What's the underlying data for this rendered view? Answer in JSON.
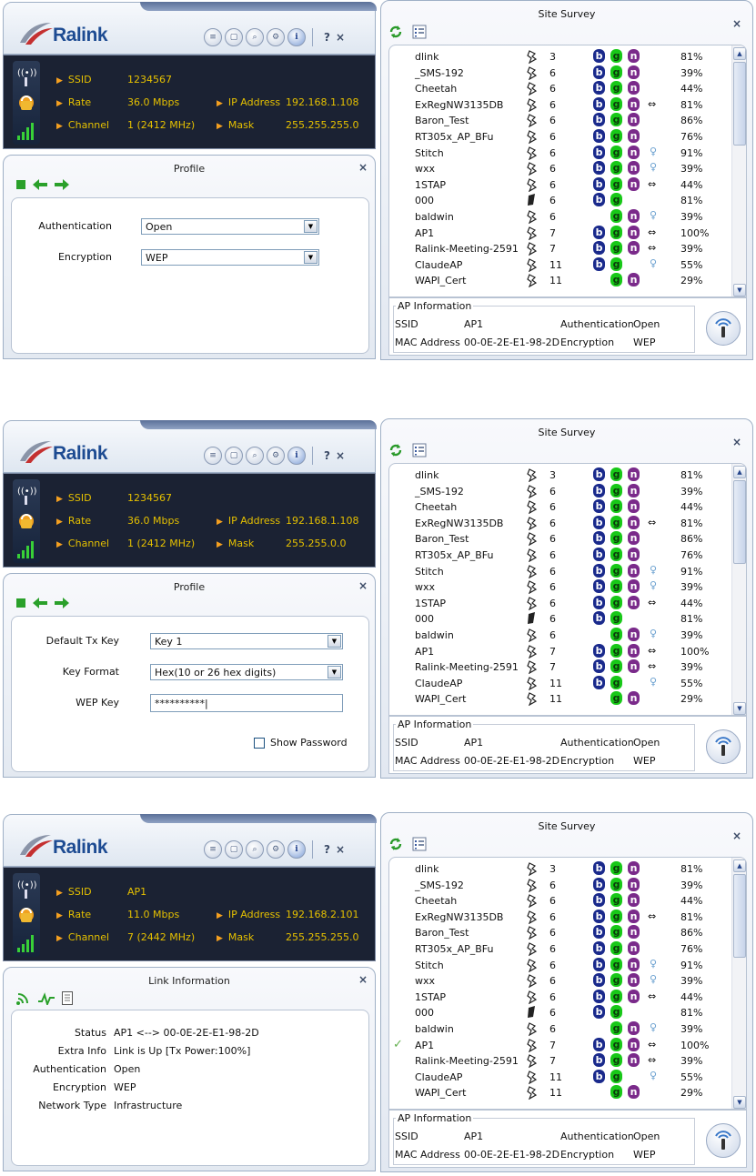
{
  "brand": {
    "logo_text": "Ralink"
  },
  "toolbar": {
    "help": "?",
    "close": "×",
    "info": "i"
  },
  "labels": {
    "ssid": "SSID",
    "rate": "Rate",
    "channel": "Channel",
    "ip": "IP Address",
    "mask": "Mask"
  },
  "survey_common": {
    "title": "Site Survey",
    "close": "×",
    "ap_legend": "AP Information",
    "ap_ssid_label": "SSID",
    "ap_ssid": "AP1",
    "ap_auth_label": "Authentication",
    "ap_auth": "Open",
    "ap_mac_label": "MAC Address",
    "ap_mac": "00-0E-2E-E1-98-2D",
    "ap_enc_label": "Encryption",
    "ap_enc": "WEP",
    "networks": [
      {
        "ssid": "dlink",
        "channel": "3",
        "b": true,
        "g": true,
        "n": true,
        "extra": "",
        "signal": "81%"
      },
      {
        "ssid": "_SMS-192",
        "channel": "6",
        "b": true,
        "g": true,
        "n": true,
        "extra": "",
        "signal": "39%"
      },
      {
        "ssid": "Cheetah",
        "channel": "6",
        "b": true,
        "g": true,
        "n": true,
        "extra": "",
        "signal": "44%"
      },
      {
        "ssid": "ExRegNW3135DB",
        "channel": "6",
        "b": true,
        "g": true,
        "n": true,
        "extra": "40mhz",
        "signal": "81%"
      },
      {
        "ssid": "Baron_Test",
        "channel": "6",
        "b": true,
        "g": true,
        "n": true,
        "extra": "",
        "signal": "86%"
      },
      {
        "ssid": "RT305x_AP_BFu",
        "channel": "6",
        "b": true,
        "g": true,
        "n": true,
        "extra": "",
        "signal": "76%"
      },
      {
        "ssid": "Stitch",
        "channel": "6",
        "b": true,
        "g": true,
        "n": true,
        "extra": "wps",
        "signal": "91%"
      },
      {
        "ssid": "wxx",
        "channel": "6",
        "b": true,
        "g": true,
        "n": true,
        "extra": "wps",
        "signal": "39%"
      },
      {
        "ssid": "1STAP",
        "channel": "6",
        "b": true,
        "g": true,
        "n": true,
        "extra": "40mhz",
        "signal": "44%"
      },
      {
        "ssid": "000",
        "channel": "6",
        "b": true,
        "g": true,
        "n": false,
        "extra": "",
        "signal": "81%"
      },
      {
        "ssid": "baldwin",
        "channel": "6",
        "b": false,
        "g": true,
        "n": true,
        "extra": "wps",
        "signal": "39%"
      },
      {
        "ssid": "AP1",
        "channel": "7",
        "b": true,
        "g": true,
        "n": true,
        "extra": "40mhz",
        "signal": "100%"
      },
      {
        "ssid": "Ralink-Meeting-2591",
        "channel": "7",
        "b": true,
        "g": true,
        "n": true,
        "extra": "40mhz",
        "signal": "39%"
      },
      {
        "ssid": "ClaudeAP",
        "channel": "11",
        "b": true,
        "g": true,
        "n": false,
        "extra": "wps",
        "signal": "55%"
      },
      {
        "ssid": "WAPI_Cert",
        "channel": "11",
        "b": false,
        "g": true,
        "n": true,
        "extra": "",
        "signal": "29%"
      }
    ]
  },
  "scenes": [
    {
      "status": {
        "ssid": "1234567",
        "rate": "36.0 Mbps",
        "channel": "1 (2412 MHz)",
        "ip": "192.168.1.108",
        "mask": "255.255.255.0"
      },
      "profile": {
        "title": "Profile",
        "close": "×",
        "auth_label": "Authentication",
        "auth_value": "Open",
        "enc_label": "Encryption",
        "enc_value": "WEP"
      }
    },
    {
      "status": {
        "ssid": "1234567",
        "rate": "36.0 Mbps",
        "channel": "1 (2412 MHz)",
        "ip": "192.168.1.108",
        "mask": "255.255.0.0"
      },
      "profile": {
        "title": "Profile",
        "close": "×",
        "txkey_label": "Default Tx Key",
        "txkey_value": "Key 1",
        "format_label": "Key Format",
        "format_value": "Hex(10 or 26 hex digits)",
        "wep_label": "WEP Key",
        "wep_value": "**********",
        "show_password": "Show Password"
      }
    },
    {
      "status": {
        "ssid": "AP1",
        "rate": "11.0 Mbps",
        "channel": "7 (2442 MHz)",
        "ip": "192.168.2.101",
        "mask": "255.255.255.0"
      },
      "link": {
        "title": "Link Information",
        "close": "×",
        "status_label": "Status",
        "status_value": "AP1 <--> 00-0E-2E-E1-98-2D",
        "extra_label": "Extra Info",
        "extra_value": "Link is Up  [Tx Power:100%]",
        "auth_label": "Authentication",
        "auth_value": "Open",
        "enc_label": "Encryption",
        "enc_value": "WEP",
        "type_label": "Network Type",
        "type_value": "Infrastructure"
      },
      "connected_ssid": "AP1"
    }
  ]
}
